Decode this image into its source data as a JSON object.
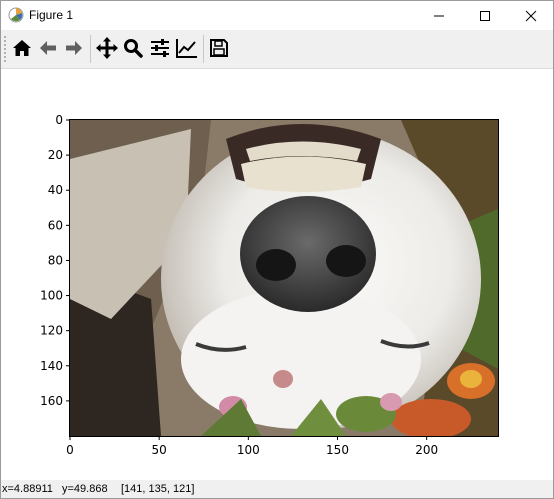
{
  "window": {
    "title": "Figure 1",
    "app_icon": "matplotlib-icon",
    "controls": [
      "minimize-icon",
      "maximize-icon",
      "close-icon"
    ]
  },
  "toolbar": {
    "buttons": [
      {
        "name": "home-button",
        "icon": "home-icon",
        "tooltip": "Reset original view"
      },
      {
        "name": "back-button",
        "icon": "arrow-left-icon",
        "tooltip": "Back to previous view"
      },
      {
        "name": "forward-button",
        "icon": "arrow-right-icon",
        "tooltip": "Forward to next view"
      },
      {
        "name": "pan-button",
        "icon": "move-icon",
        "tooltip": "Pan axes"
      },
      {
        "name": "zoom-button",
        "icon": "magnifier-icon",
        "tooltip": "Zoom to rectangle"
      },
      {
        "name": "subplots-button",
        "icon": "sliders-icon",
        "tooltip": "Configure subplots"
      },
      {
        "name": "axes-button",
        "icon": "line-chart-icon",
        "tooltip": "Edit axis"
      },
      {
        "name": "save-button",
        "icon": "floppy-disk-icon",
        "tooltip": "Save the figure"
      }
    ]
  },
  "plot": {
    "image_description": "upside-down white dog face with nose and teeth, flowers",
    "x_ticks": [
      "0",
      "50",
      "100",
      "150",
      "200"
    ],
    "y_ticks": [
      "0",
      "20",
      "40",
      "60",
      "80",
      "100",
      "120",
      "140",
      "160"
    ],
    "x_range": [
      0,
      240
    ],
    "y_range": [
      0,
      180
    ],
    "colors": {
      "fur": "#f2f0ee",
      "nose": "#3a3a3a",
      "background_left": "#7a6a58",
      "flowers": "#d8702a",
      "foliage": "#4f6a2a"
    }
  },
  "status": {
    "x": "x=4.88911",
    "y": "y=49.868",
    "pixel": "[141, 135, 121]"
  }
}
